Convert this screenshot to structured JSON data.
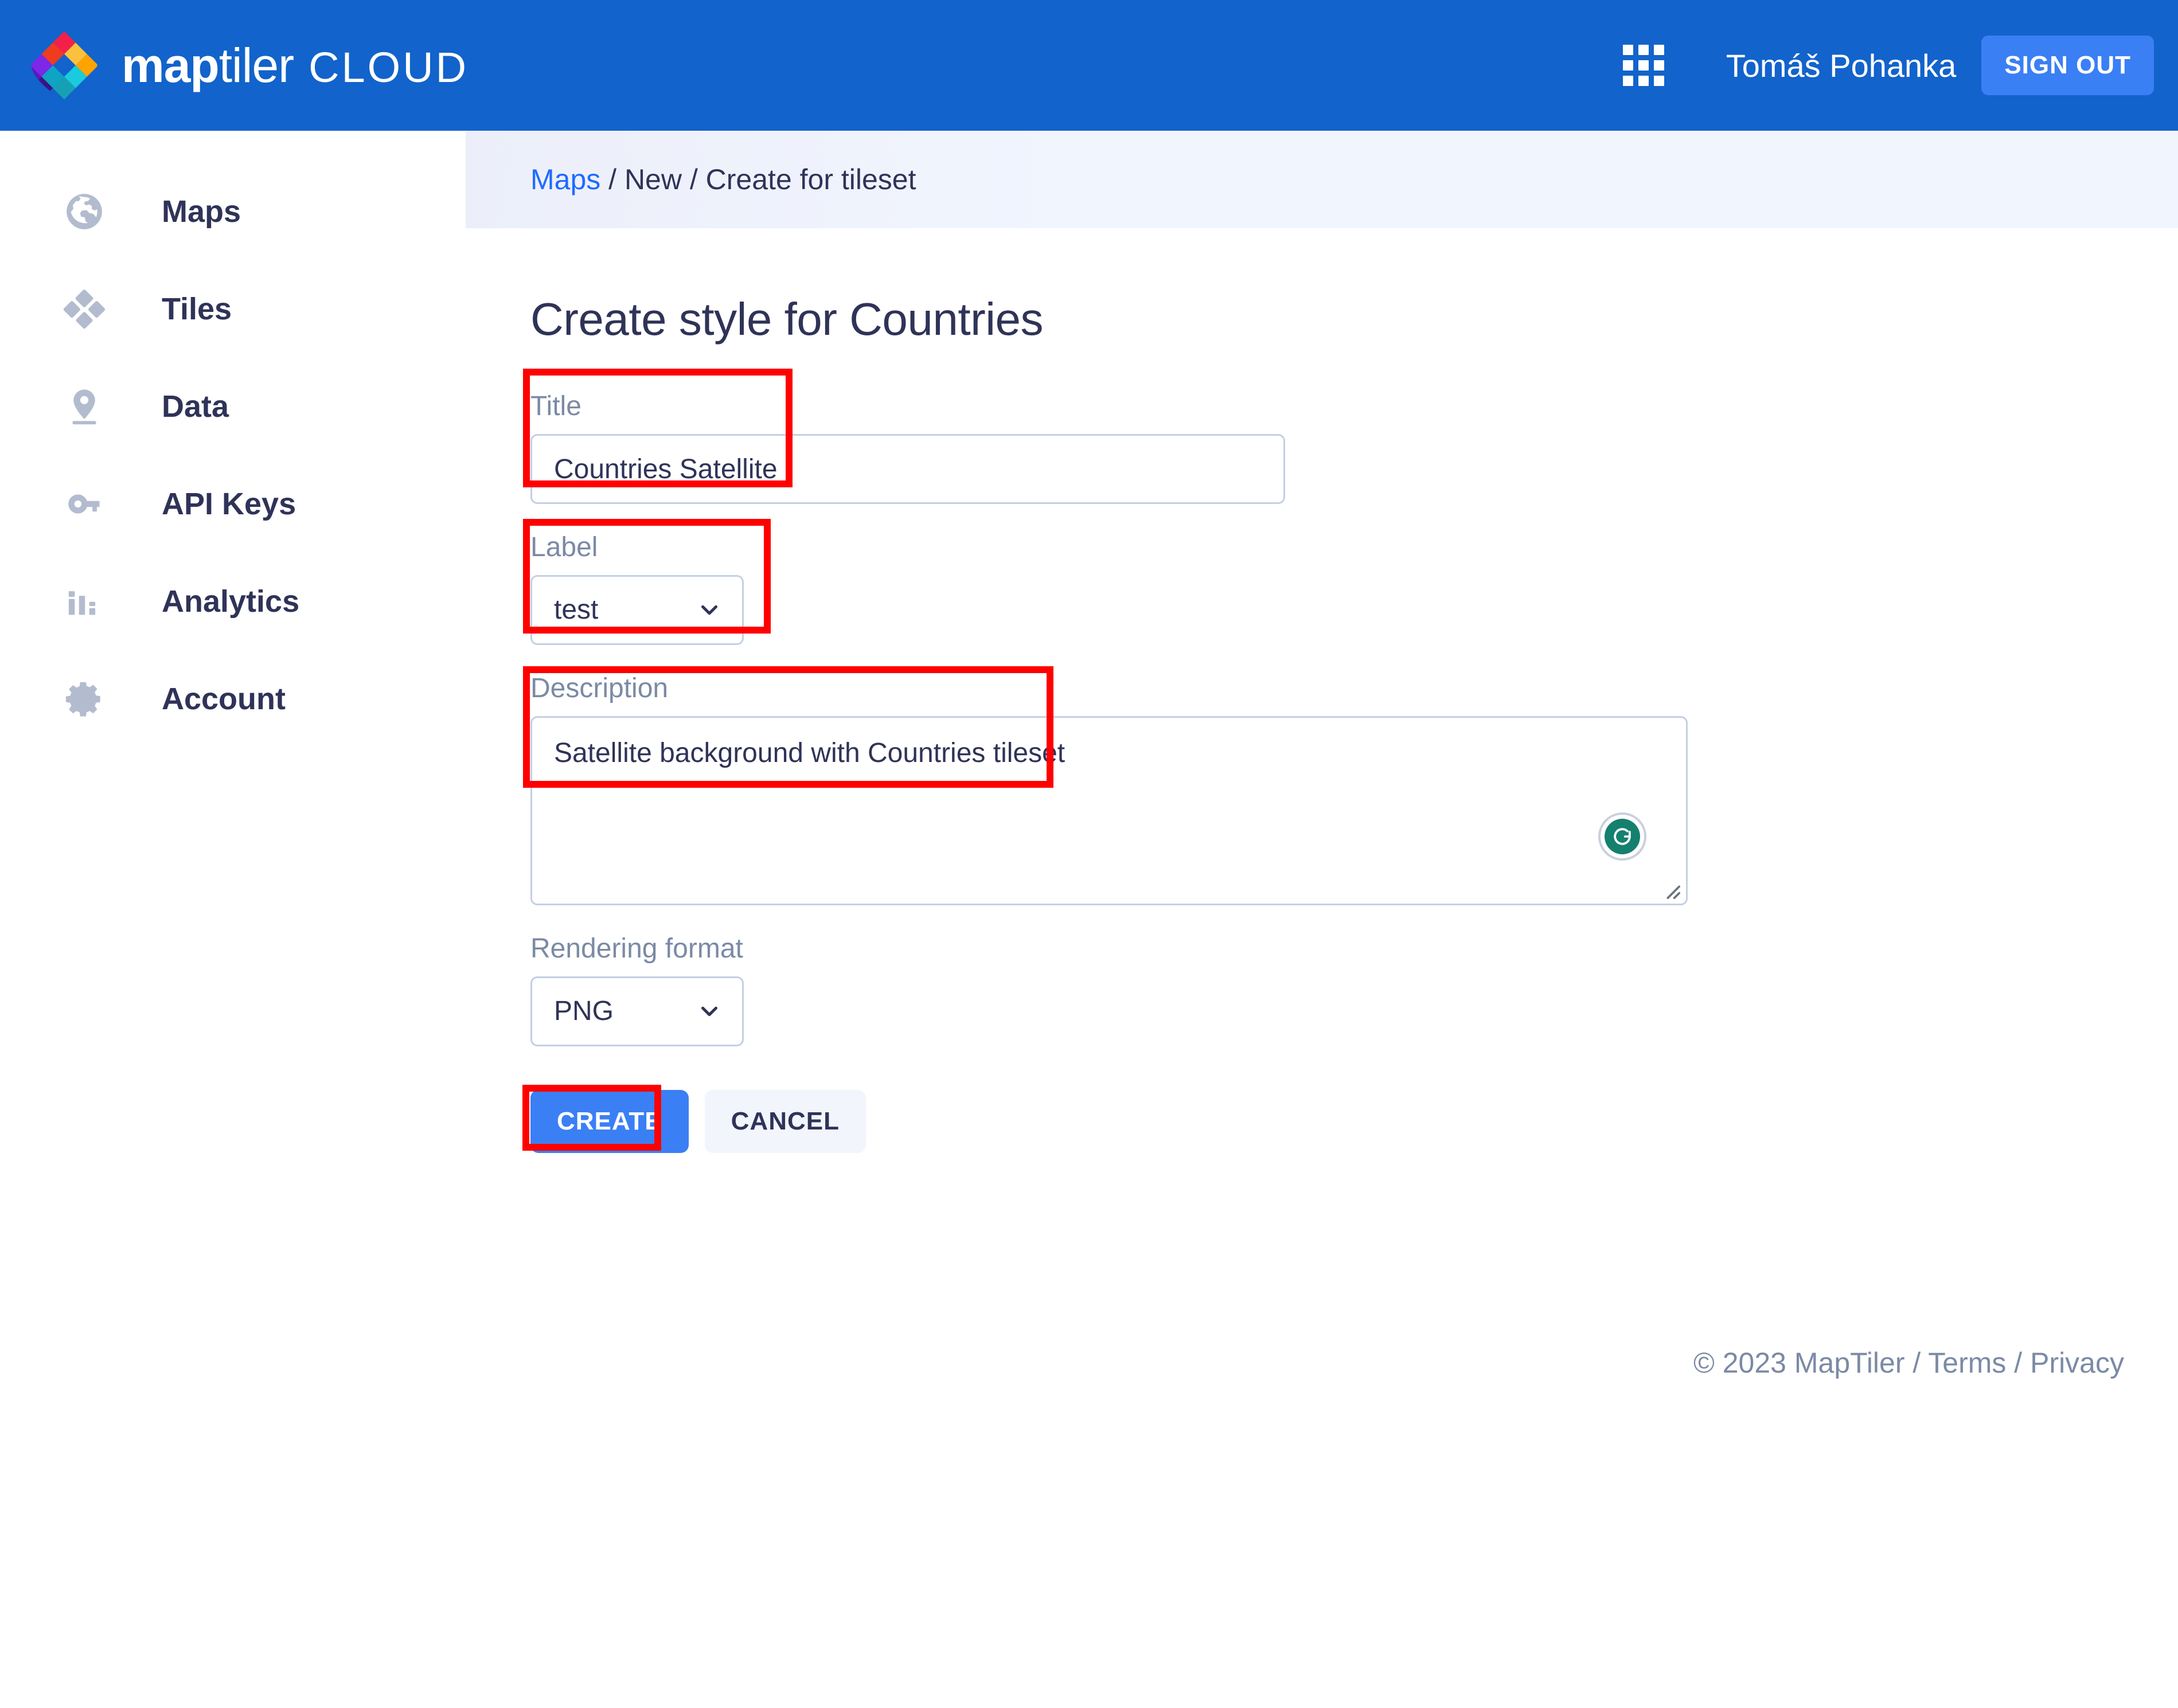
{
  "header": {
    "brand_bold": "map",
    "brand_light": "tiler",
    "brand_suffix": "CLOUD",
    "apps_icon": "apps-grid-icon",
    "user_name": "Tomáš Pohanka",
    "sign_out_label": "SIGN OUT",
    "bg_color": "#1263cb",
    "signout_color": "#3b7ff5"
  },
  "sidebar": {
    "items": [
      {
        "label": "Maps",
        "icon": "globe-icon"
      },
      {
        "label": "Tiles",
        "icon": "tiles-diamond-icon"
      },
      {
        "label": "Data",
        "icon": "map-pin-icon"
      },
      {
        "label": "API Keys",
        "icon": "key-icon"
      },
      {
        "label": "Analytics",
        "icon": "bar-chart-icon"
      },
      {
        "label": "Account",
        "icon": "gear-icon"
      }
    ]
  },
  "breadcrumb": {
    "link": "Maps",
    "sep1": " / ",
    "item2": "New",
    "sep2": " / ",
    "item3": "Create for tileset",
    "link_color": "#1f6bff"
  },
  "page": {
    "title": "Create style for Countries"
  },
  "form": {
    "title_field": {
      "label": "Title",
      "value": "Countries Satellite",
      "placeholder": ""
    },
    "label_field": {
      "label": "Label",
      "value": "test",
      "chevron_icon": "chevron-down-icon"
    },
    "description_field": {
      "label": "Description",
      "value": "Satellite background with Countries tileset",
      "placeholder": "",
      "badge_icon": "grammarly-icon",
      "resize_icon": "resize-handle-icon"
    },
    "rendering_field": {
      "label": "Rendering format",
      "value": "PNG",
      "chevron_icon": "chevron-down-icon"
    },
    "create_label": "CREATE",
    "cancel_label": "CANCEL"
  },
  "footer": {
    "copyright": "© 2023 MapTiler",
    "sep1": " / ",
    "terms": "Terms",
    "sep2": " / ",
    "privacy": "Privacy"
  },
  "annotations": {
    "color": "#ff0000",
    "boxes": [
      "title-field",
      "label-field",
      "description-field",
      "create-button"
    ]
  }
}
